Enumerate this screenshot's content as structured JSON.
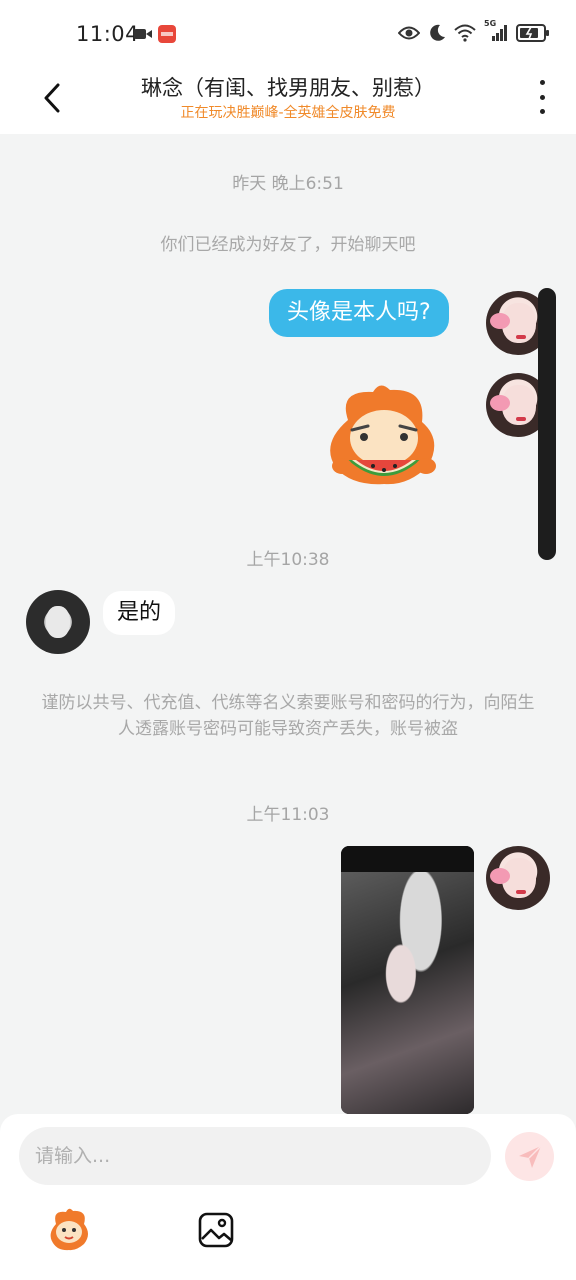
{
  "status_bar": {
    "time": "11:04",
    "signal_label": "5G",
    "icons": [
      "camera-icon",
      "app-notification-icon",
      "eye-icon",
      "moon-icon",
      "wifi-icon",
      "signal-icon",
      "battery-icon"
    ]
  },
  "header": {
    "title": "琳念（有闺、找男朋友、别惹）",
    "subtitle": "正在玩决胜巅峰-全英雄全皮肤免费"
  },
  "chat": {
    "timestamp_1": "昨天 晚上6:51",
    "friend_notice": "你们已经成为好友了，开始聊天吧",
    "msg_question": "头像是本人吗?",
    "timestamp_2": "上午10:38",
    "msg_reply": "是的",
    "security_notice": "谨防以共号、代充值、代练等名义索要账号和密码的行为，向陌生人透露账号密码可能导致资产丢失，账号被盗",
    "timestamp_3": "上午11:03"
  },
  "input": {
    "placeholder": "请输入..."
  },
  "colors": {
    "bubble_me": "#3bb8e9",
    "subtitle_accent": "#f08a2a",
    "background": "#f3f4f4"
  }
}
